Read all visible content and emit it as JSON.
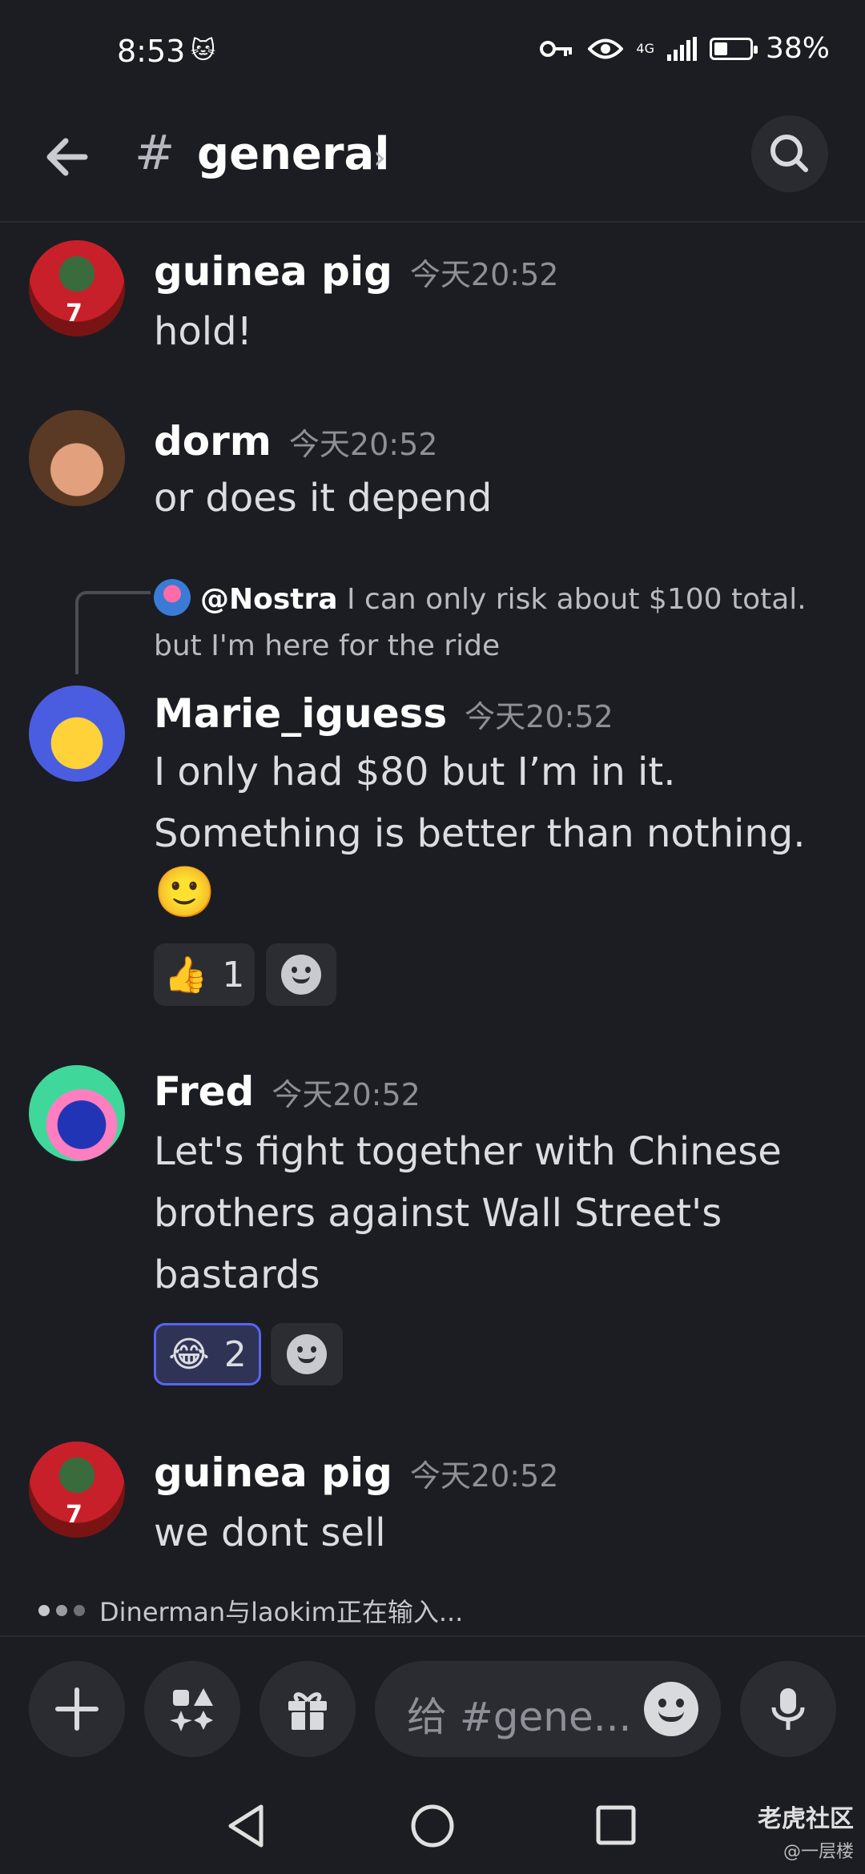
{
  "status_bar": {
    "time": "8:53",
    "network": "4G",
    "battery": "38%",
    "battery_level": 0.38
  },
  "header": {
    "hash": "#",
    "channel": "general",
    "chevron": "›"
  },
  "messages": [
    {
      "author": "guinea pig",
      "timestamp": "今天20:52",
      "text": "hold!"
    },
    {
      "author": "dorm",
      "timestamp": "今天20:52",
      "text": "or does it depend"
    },
    {
      "reply": {
        "user": "@Nostra",
        "text": "I can only risk about $100 total. but I'm here for the ride"
      },
      "author": "Marie_iguess",
      "timestamp": "今天20:52",
      "text": "I only had $80 but I’m in it. Something is better than nothing.",
      "emoji": "🙂",
      "reactions": [
        {
          "emoji": "👍",
          "count": "1"
        }
      ]
    },
    {
      "author": "Fred",
      "timestamp": "今天20:52",
      "text": "Let's fight together with Chinese brothers against Wall Street's bastards",
      "reactions": [
        {
          "emoji": "😂",
          "count": "2"
        }
      ]
    },
    {
      "author": "guinea pig",
      "timestamp": "今天20:52",
      "text": "we dont sell"
    }
  ],
  "typing": "Dinerman与laokim正在输入...",
  "composer": {
    "placeholder": "给 #gene..."
  },
  "watermark": {
    "main": "老虎社区",
    "sub": "@一层楼"
  },
  "icons": [
    "back-arrow-icon",
    "search-icon",
    "plus-icon",
    "apps-icon",
    "gift-icon",
    "emoji-icon",
    "microphone-icon",
    "nav-back-icon",
    "nav-home-icon",
    "nav-recents-icon",
    "key-icon",
    "eye-icon",
    "signal-icon",
    "battery-icon"
  ]
}
